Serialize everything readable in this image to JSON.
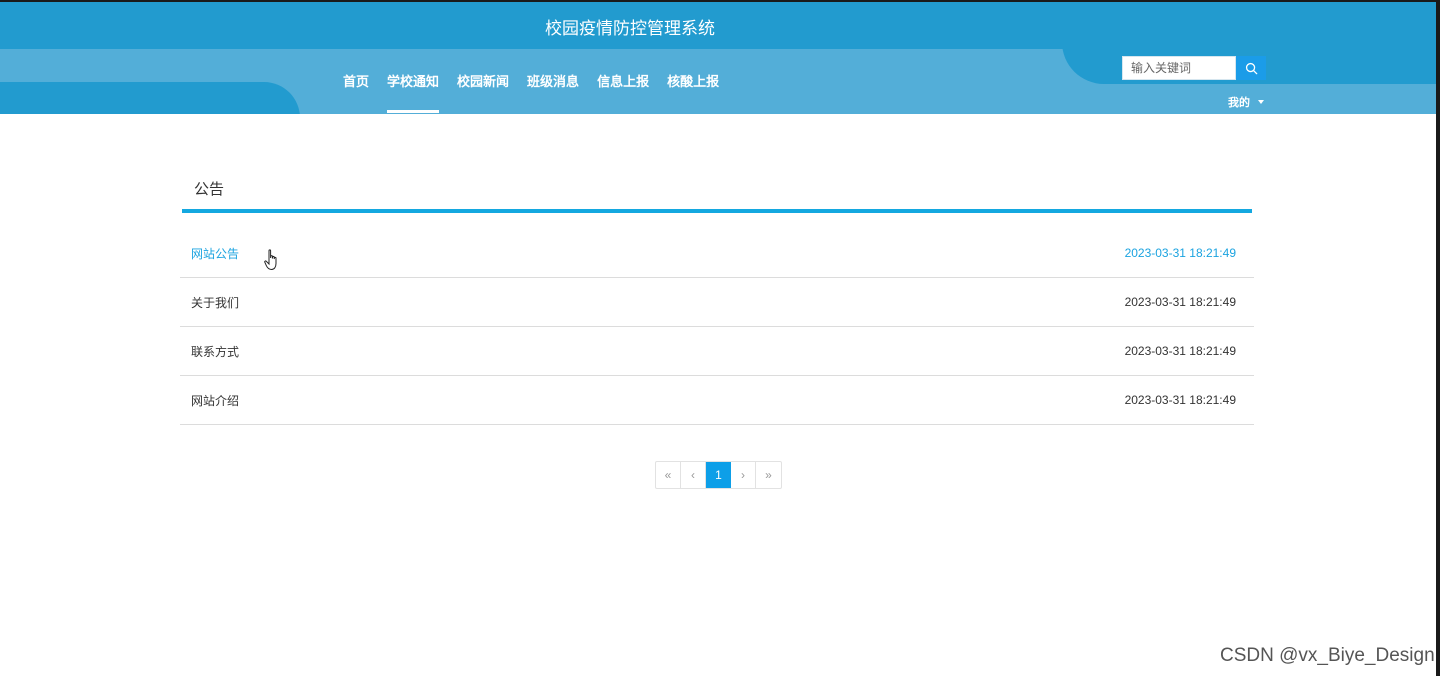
{
  "header": {
    "title": "校园疫情防控管理系统",
    "nav": [
      {
        "label": "首页",
        "active": false
      },
      {
        "label": "学校通知",
        "active": true
      },
      {
        "label": "校园新闻",
        "active": false
      },
      {
        "label": "班级消息",
        "active": false
      },
      {
        "label": "信息上报",
        "active": false
      },
      {
        "label": "核酸上报",
        "active": false
      }
    ],
    "search": {
      "placeholder": "输入关键词",
      "value": ""
    },
    "user_menu": "我的"
  },
  "section": {
    "title": "公告"
  },
  "notices": [
    {
      "title": "网站公告",
      "time": "2023-03-31 18:21:49",
      "hovered": true
    },
    {
      "title": "关于我们",
      "time": "2023-03-31 18:21:49",
      "hovered": false
    },
    {
      "title": "联系方式",
      "time": "2023-03-31 18:21:49",
      "hovered": false
    },
    {
      "title": "网站介绍",
      "time": "2023-03-31 18:21:49",
      "hovered": false
    }
  ],
  "pagination": {
    "first": "«",
    "prev": "‹",
    "current": "1",
    "next": "›",
    "last": "»"
  },
  "watermark": "CSDN @vx_Biye_Design",
  "colors": {
    "header_dark": "#229bcf",
    "header_light": "#53aed8",
    "accent": "#14a8e0",
    "page_active": "#0d9fe8"
  },
  "icons": {
    "search": "search-icon",
    "dropdown": "caret-down-icon",
    "cursor": "hand-pointer-icon"
  }
}
